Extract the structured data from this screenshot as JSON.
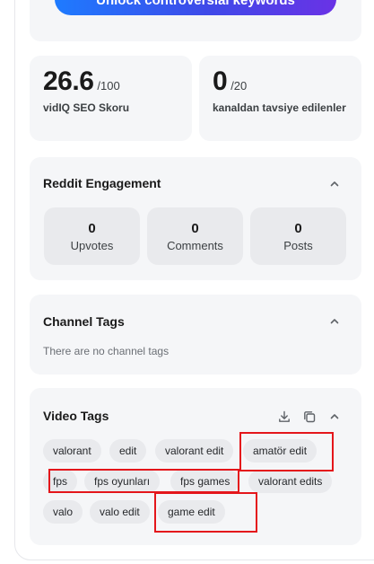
{
  "unlock_button": {
    "label": "Unlock controversial keywords"
  },
  "scores": [
    {
      "value": "26.6",
      "max": "/100",
      "label": "vidIQ SEO Skoru"
    },
    {
      "value": "0",
      "max": "/20",
      "label": "kanaldan tavsiye edilenler"
    }
  ],
  "reddit": {
    "title": "Reddit Engagement",
    "stats": [
      {
        "value": "0",
        "label": "Upvotes"
      },
      {
        "value": "0",
        "label": "Comments"
      },
      {
        "value": "0",
        "label": "Posts"
      }
    ]
  },
  "channel_tags": {
    "title": "Channel Tags",
    "empty_text": "There are no channel tags"
  },
  "video_tags": {
    "title": "Video Tags",
    "tags": [
      "valorant",
      "edit",
      "valorant edit",
      "amatör edit",
      "fps",
      "fps oyunları",
      "fps games",
      "valorant edits",
      "valo",
      "valo edit",
      "game edit"
    ]
  },
  "icons": {
    "collapse": "chevron-up-icon",
    "download": "download-icon",
    "copy": "copy-icon"
  },
  "colors": {
    "highlight": "#e4161b",
    "gradient_start": "#1e7bff",
    "gradient_end": "#6a32e6"
  }
}
